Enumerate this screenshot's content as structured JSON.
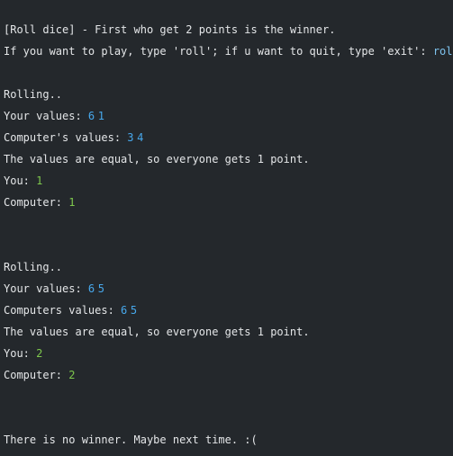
{
  "console": {
    "intro": {
      "title": "[Roll dice] - First who get 2 points is the winner.",
      "prompt": "If you want to play, type 'roll'; if u want to quit, type 'exit': ",
      "typed_input": "roll"
    },
    "rounds": [
      {
        "rolling": "Rolling..",
        "your_label": "Your values: ",
        "your_values": [
          "6",
          "1"
        ],
        "computer_label": "Computer's values: ",
        "computer_values": [
          "3",
          "4"
        ],
        "result": "The values are equal, so everyone gets 1 point.",
        "you_label": "You: ",
        "you_score": "1",
        "computer_score_label": "Computer: ",
        "computer_score": "1"
      },
      {
        "rolling": "Rolling..",
        "your_label": "Your values: ",
        "your_values": [
          "6",
          "5"
        ],
        "computer_label": "Computers values: ",
        "computer_values": [
          "6",
          "5"
        ],
        "result": "The values are equal, so everyone gets 1 point.",
        "you_label": "You: ",
        "you_score": "2",
        "computer_score_label": "Computer: ",
        "computer_score": "2"
      }
    ],
    "final": "There is no winner. Maybe next time. :("
  },
  "colors": {
    "background": "#24282c",
    "text": "#e4e6e8",
    "dice_value": "#47a8ec",
    "score": "#7ec84d",
    "user_input": "#7ec3ee"
  }
}
